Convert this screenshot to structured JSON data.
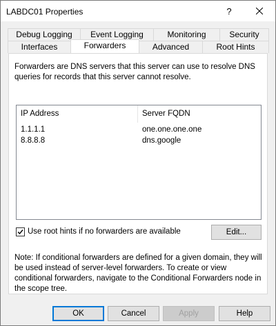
{
  "window": {
    "title": "LABDC01 Properties",
    "help_glyph": "?"
  },
  "tabs_row1": [
    {
      "label": "Debug Logging"
    },
    {
      "label": "Event Logging"
    },
    {
      "label": "Monitoring"
    },
    {
      "label": "Security"
    }
  ],
  "tabs_row2": [
    {
      "label": "Interfaces"
    },
    {
      "label": "Forwarders",
      "active": true
    },
    {
      "label": "Advanced"
    },
    {
      "label": "Root Hints"
    }
  ],
  "forwarders": {
    "description": "Forwarders are DNS servers that this server can use to resolve DNS queries for records that this server cannot resolve.",
    "columns": [
      "IP Address",
      "Server FQDN"
    ],
    "rows": [
      {
        "ip": "1.1.1.1",
        "fqdn": "one.one.one.one"
      },
      {
        "ip": "8.8.8.8",
        "fqdn": "dns.google"
      }
    ],
    "use_root_hints_label": "Use root hints if no forwarders are available",
    "use_root_hints_checked": true,
    "edit_label": "Edit...",
    "note": "Note: If conditional forwarders are defined for a given domain, they will be used instead of server-level forwarders.  To create or view conditional forwarders, navigate to the Conditional Forwarders node in the scope tree."
  },
  "buttons": {
    "ok": "OK",
    "cancel": "Cancel",
    "apply": "Apply",
    "help": "Help"
  }
}
